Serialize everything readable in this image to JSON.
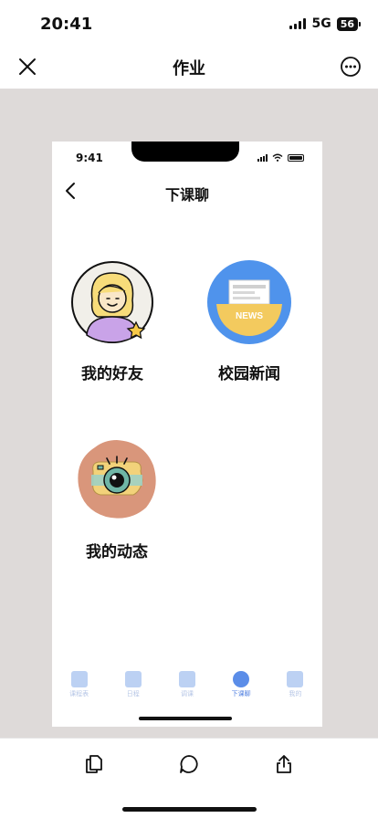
{
  "status_bar": {
    "time": "20:41",
    "network": "5G",
    "battery": "56"
  },
  "nav": {
    "title": "作业",
    "close_icon": "close-icon",
    "more_icon": "more-icon"
  },
  "preview": {
    "time": "9:41",
    "title": "下课聊",
    "tiles": [
      {
        "label": "我的好友",
        "icon": "friends-avatar-icon"
      },
      {
        "label": "校园新闻",
        "icon": "news-icon",
        "badge_text": "NEWS"
      },
      {
        "label": "我的动态",
        "icon": "moments-camera-icon"
      }
    ],
    "tabs": [
      {
        "label": "课程表",
        "icon": "timetable-icon",
        "active": false
      },
      {
        "label": "日程",
        "icon": "schedule-icon",
        "active": false
      },
      {
        "label": "调课",
        "icon": "reschedule-icon",
        "active": false
      },
      {
        "label": "下课聊",
        "icon": "chat-icon",
        "active": true
      },
      {
        "label": "我的",
        "icon": "profile-icon",
        "active": false
      }
    ],
    "colors": {
      "tab_active": "#4f7fe0",
      "tab_inactive": "#b6c6e6",
      "news_blue": "#4f93ec",
      "news_yellow": "#f3ca5e",
      "moments_bg": "#d9967b",
      "friend_purple": "#c9a3e8"
    }
  },
  "toolbar": {
    "icons": [
      "copy-icon",
      "comment-icon",
      "share-icon"
    ]
  },
  "colors": {
    "frame": "#dedad9"
  }
}
